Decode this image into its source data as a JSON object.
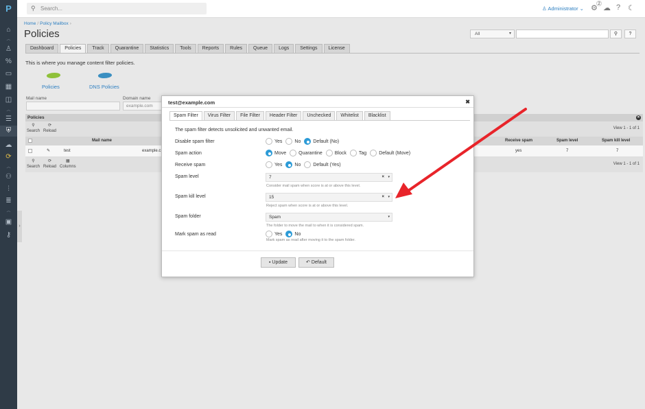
{
  "app": {
    "logo": "P"
  },
  "topbar": {
    "search_placeholder": "Search...",
    "user": "Administrator",
    "notif_count": "2"
  },
  "breadcrumb": {
    "home": "Home",
    "current": "Policy Mailbox"
  },
  "page_title": "Policies",
  "filter": {
    "selected": "All"
  },
  "tabs": [
    "Dashboard",
    "Policies",
    "Track",
    "Quarantine",
    "Statistics",
    "Tools",
    "Reports",
    "Rules",
    "Queue",
    "Logs",
    "Settings",
    "License"
  ],
  "active_tab": "Policies",
  "intro": "This is where you manage content filter policies.",
  "policy_types": [
    {
      "label": "Policies",
      "color": "#8fc13a"
    },
    {
      "label": "DNS Policies",
      "color": "#3a8fc1"
    }
  ],
  "search_fields": {
    "mail_name_label": "Mail name",
    "domain_name_label": "Domain name",
    "domain_name_placeholder": "example.com"
  },
  "grid": {
    "title": "Policies",
    "toolbar_top": {
      "search": "Search",
      "reload": "Reload"
    },
    "toolbar_bottom": {
      "search": "Search",
      "reload": "Reload",
      "columns": "Columns"
    },
    "view_text": "View 1 - 1 of 1",
    "columns": {
      "mail_name": "Mail name",
      "receive_spam": "Receive spam",
      "spam_level": "Spam level",
      "spam_kill_level": "Spam kill level"
    },
    "rows": [
      {
        "name": "test",
        "domain": "example.c",
        "receive_spam": "yes",
        "spam_level": "7",
        "spam_kill_level": "7"
      }
    ]
  },
  "modal": {
    "title": "test@example.com",
    "tabs": [
      "Spam Filter",
      "Virus Filter",
      "File Filter",
      "Header Filter",
      "Unchecked",
      "Whitelist",
      "Blacklist"
    ],
    "active_tab": "Spam Filter",
    "description": "The spam filter detects unsolicited and unwanted email.",
    "fields": {
      "disable_spam_filter": {
        "label": "Disable spam filter",
        "options": [
          "Yes",
          "No",
          "Default (No)"
        ],
        "selected": 2
      },
      "spam_action": {
        "label": "Spam action",
        "options": [
          "Move",
          "Quarantine",
          "Block",
          "Tag",
          "Default (Move)"
        ],
        "selected": 0
      },
      "receive_spam": {
        "label": "Receive spam",
        "options": [
          "Yes",
          "No",
          "Default (Yes)"
        ],
        "selected": 1
      },
      "spam_level": {
        "label": "Spam level",
        "value": "7",
        "hint": "Consider mail spam when score is at or above this level."
      },
      "spam_kill_level": {
        "label": "Spam kill level",
        "value": "15",
        "hint": "Reject spam when score is at or above this level."
      },
      "spam_folder": {
        "label": "Spam folder",
        "value": "Spam",
        "hint": "The folder to move the mail to when it is considered spam."
      },
      "mark_spam_as_read": {
        "label": "Mark spam as read",
        "options": [
          "Yes",
          "No"
        ],
        "selected": 1,
        "hint": "Mark spam as read after moving it to the spam folder."
      }
    },
    "buttons": {
      "update": "Update",
      "default": "Default"
    }
  },
  "annotation": {
    "arrow_color": "#e8242a"
  }
}
